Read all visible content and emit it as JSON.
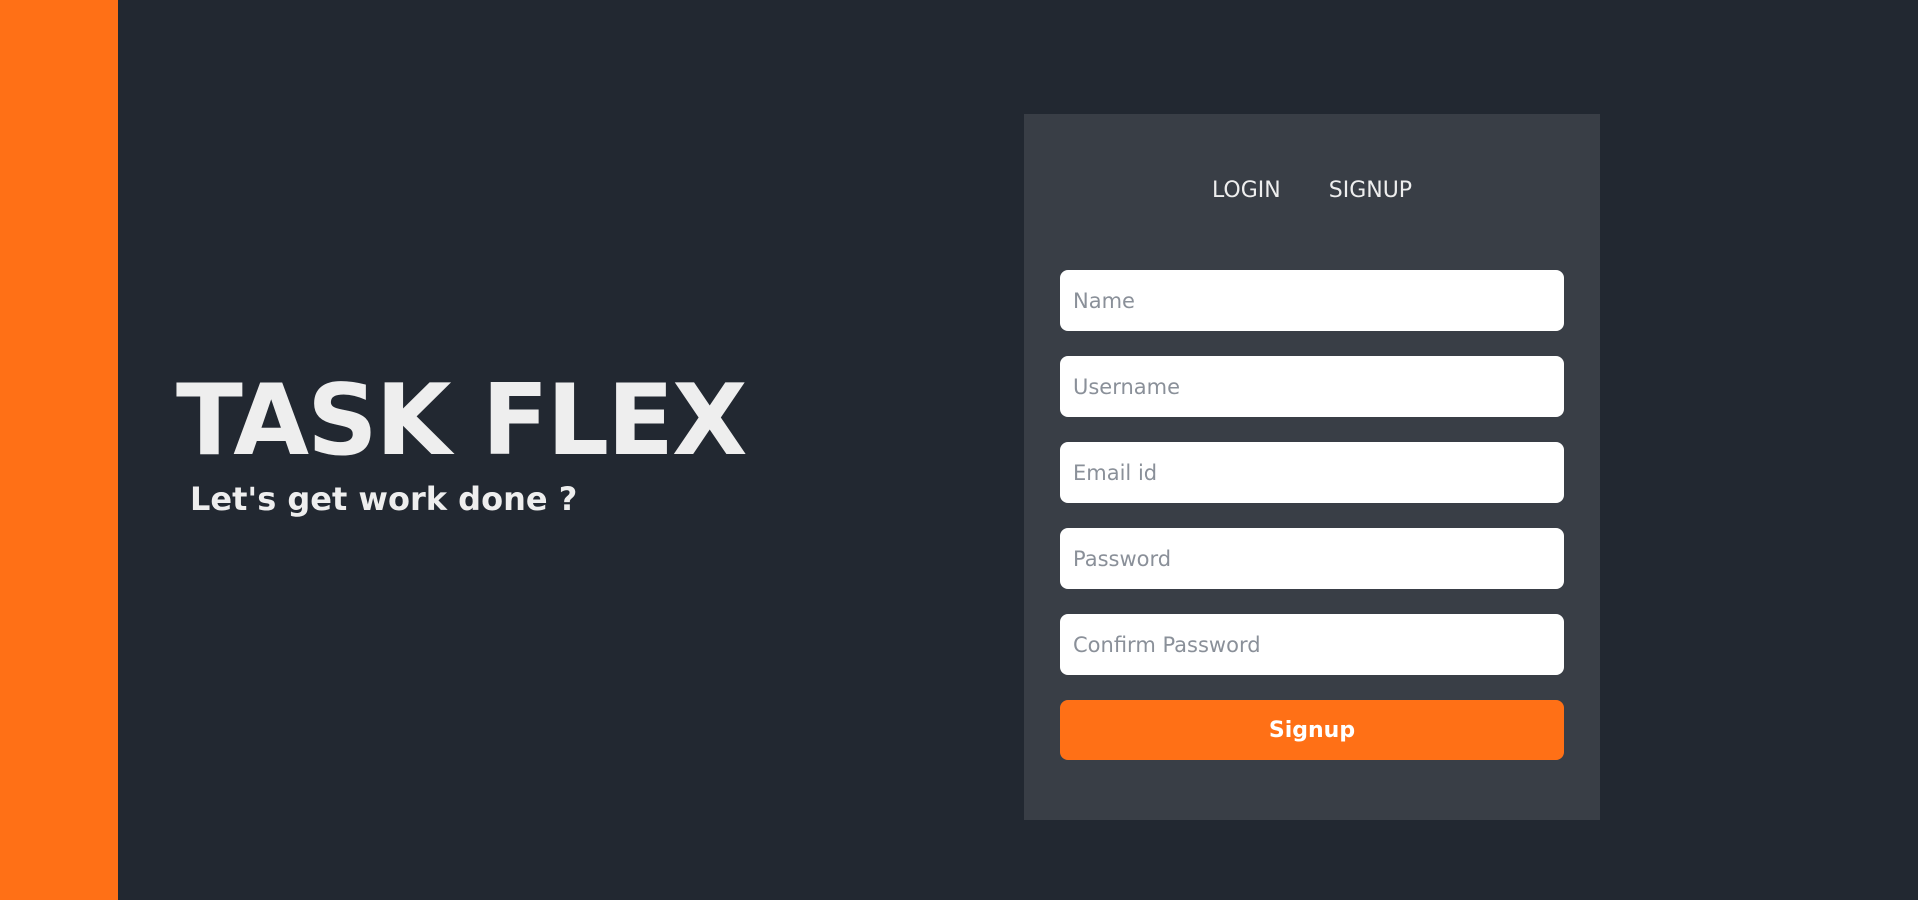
{
  "colors": {
    "accent": "#ff7016",
    "background": "#222831",
    "card": "#393e46",
    "text": "#eeeeee"
  },
  "brand": {
    "title": "TASK FLEX",
    "tagline": "Let's get work done ?"
  },
  "auth": {
    "tabs": [
      {
        "label": "LOGIN"
      },
      {
        "label": "SIGNUP"
      }
    ],
    "fields": [
      {
        "placeholder": "Name",
        "value": ""
      },
      {
        "placeholder": "Username",
        "value": ""
      },
      {
        "placeholder": "Email id",
        "value": ""
      },
      {
        "placeholder": "Password",
        "value": ""
      },
      {
        "placeholder": "Confirm Password",
        "value": ""
      }
    ],
    "submit_label": "Signup"
  }
}
